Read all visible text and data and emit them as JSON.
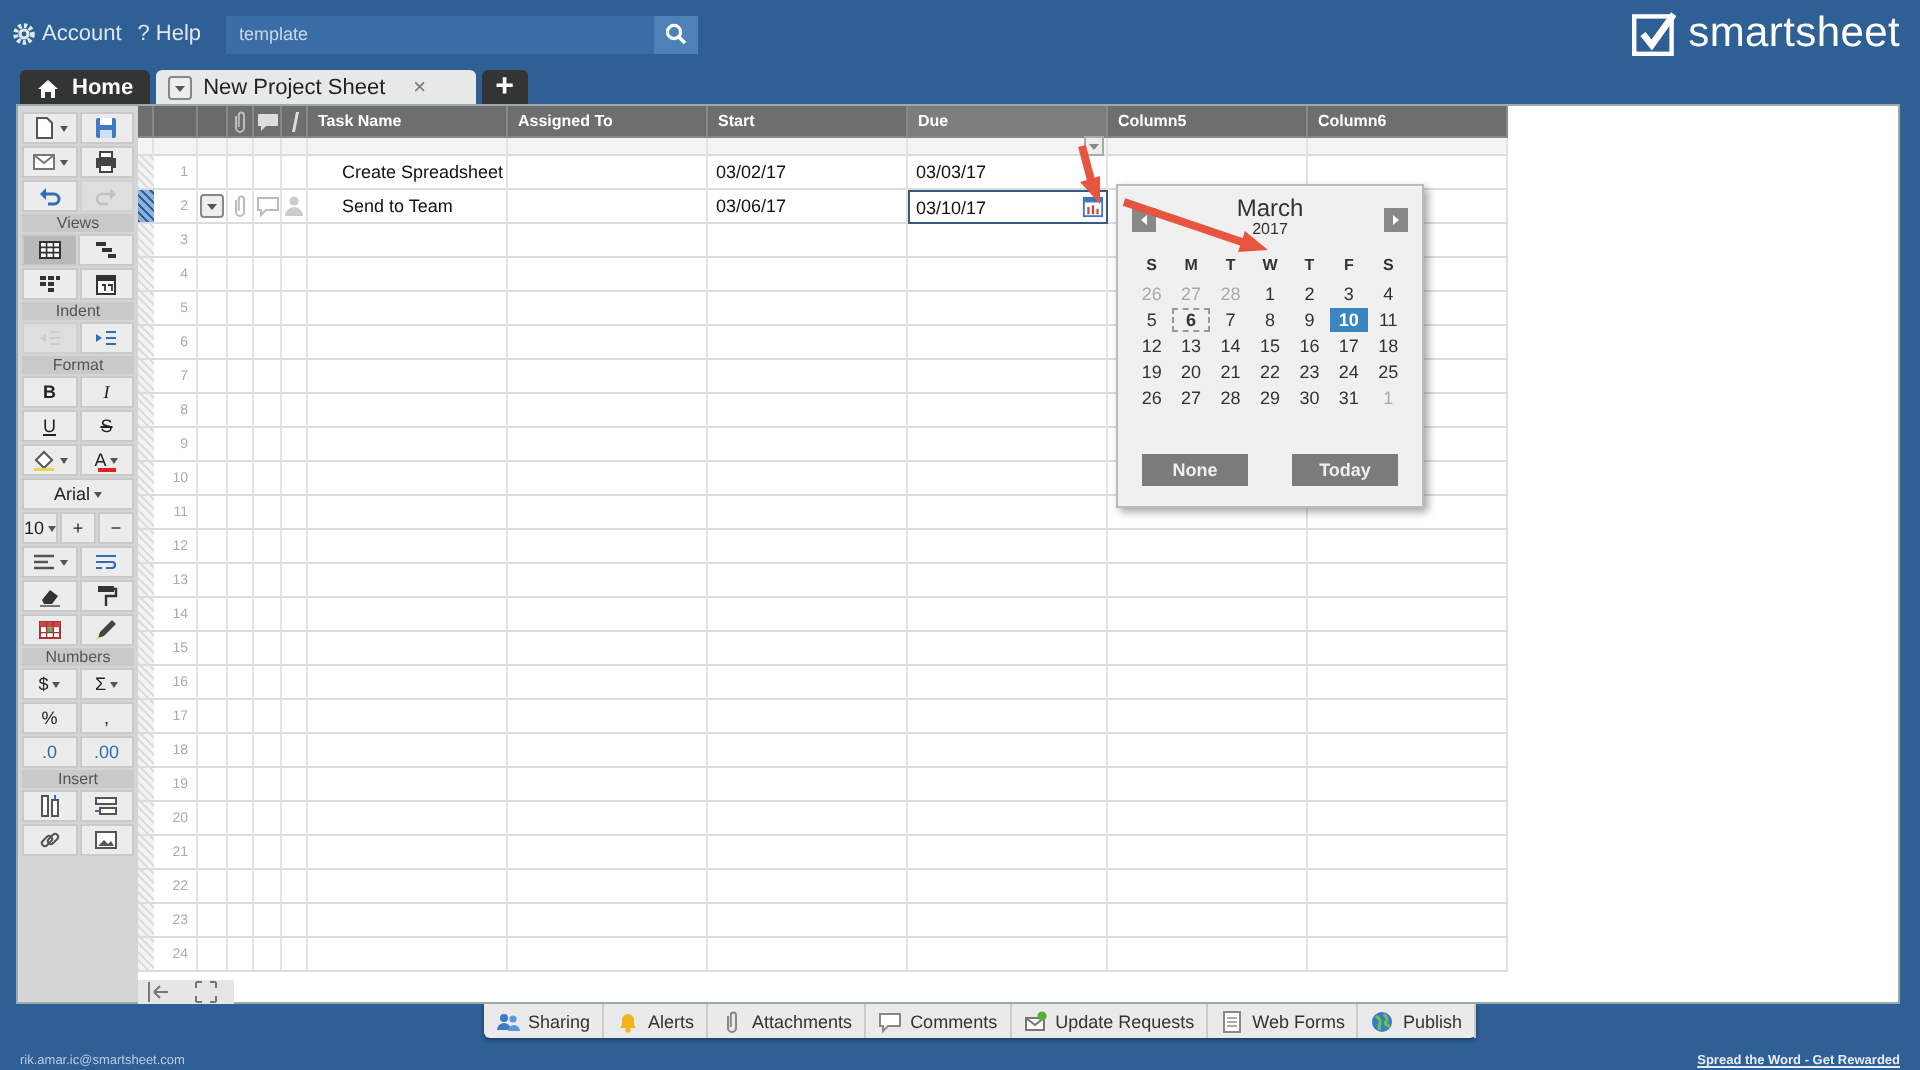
{
  "top_bar": {
    "account": "Account",
    "help": "? Help",
    "search": {
      "value": "template"
    },
    "logo": "smartsheet"
  },
  "tabs": [
    {
      "label": "Home",
      "kind": "home",
      "selected": false
    },
    {
      "label": "New Project Sheet",
      "kind": "sheet",
      "selected": true,
      "close": "×"
    },
    {
      "label": "+",
      "kind": "add",
      "selected": false
    }
  ],
  "toolbar": {
    "sections": [
      {
        "rows": [
          [
            {
              "kind": "new",
              "dropdown": true
            },
            {
              "kind": "save"
            }
          ],
          [
            {
              "kind": "email",
              "dropdown": true
            },
            {
              "kind": "print"
            }
          ],
          [
            {
              "kind": "undo",
              "disabled": false
            },
            {
              "kind": "redo",
              "disabled": true
            }
          ]
        ]
      },
      {
        "label": "Views",
        "rows": [
          [
            {
              "kind": "grid",
              "selected": true
            },
            {
              "kind": "gantt",
              "selected": false
            }
          ],
          [
            {
              "kind": "card",
              "selected": false
            },
            {
              "kind": "calendar",
              "selected": false
            }
          ]
        ]
      },
      {
        "label": "Indent",
        "rows": [
          [
            {
              "kind": "outdent",
              "disabled": true
            },
            {
              "kind": "indent",
              "disabled": false
            }
          ]
        ]
      },
      {
        "label": "Format",
        "rows": [
          [
            {
              "kind": "bold",
              "label": "B"
            },
            {
              "kind": "italic",
              "label": "I"
            }
          ],
          [
            {
              "kind": "underline",
              "label": "U"
            },
            {
              "kind": "strike",
              "label": "S"
            }
          ],
          [
            {
              "kind": "fill",
              "dropdown": true
            },
            {
              "kind": "fontcolor",
              "label": "A",
              "dropdown": true
            }
          ],
          [
            {
              "kind": "text",
              "label": "Arial",
              "dropdown": true
            }
          ],
          [
            {
              "kind": "text",
              "label": "10",
              "dropdown": true
            },
            {
              "kind": "text",
              "label": "+"
            },
            {
              "kind": "text",
              "label": "−"
            }
          ],
          [
            {
              "kind": "align",
              "dropdown": true
            },
            {
              "kind": "wrap"
            }
          ],
          [
            {
              "kind": "eraser"
            },
            {
              "kind": "roller"
            }
          ],
          [
            {
              "kind": "condfmt"
            },
            {
              "kind": "highlight"
            }
          ]
        ]
      },
      {
        "label": "Numbers",
        "rows": [
          [
            {
              "kind": "text",
              "label": "$",
              "dropdown": true
            },
            {
              "kind": "text",
              "label": "Σ",
              "dropdown": true
            }
          ],
          [
            {
              "kind": "text",
              "label": "%"
            },
            {
              "kind": "text",
              "label": ","
            }
          ],
          [
            {
              "kind": "decimal",
              "label": ".0"
            },
            {
              "kind": "decimal",
              "label": ".00"
            }
          ]
        ]
      },
      {
        "label": "Insert",
        "rows": [
          [
            {
              "kind": "insertcol"
            },
            {
              "kind": "insertrow"
            }
          ],
          [
            {
              "kind": "link"
            },
            {
              "kind": "image"
            }
          ]
        ]
      }
    ]
  },
  "sheet": {
    "columns": [
      "Task Name",
      "Assigned To",
      "Start",
      "Due",
      "Column5",
      "Column6"
    ],
    "rows": [
      {
        "number": "1",
        "selected": false,
        "task": "Create Spreadsheet",
        "start": "03/02/17",
        "due": "03/03/17",
        "due_editing": false
      },
      {
        "number": "2",
        "selected": true,
        "task": "Send to Team",
        "start": "03/06/17",
        "due": "03/10/17",
        "due_editing": true
      },
      {
        "number": "3",
        "selected": false
      },
      {
        "number": "4",
        "selected": false
      },
      {
        "number": "5",
        "selected": false
      },
      {
        "number": "6",
        "selected": false
      },
      {
        "number": "7",
        "selected": false
      },
      {
        "number": "8",
        "selected": false
      },
      {
        "number": "9",
        "selected": false
      },
      {
        "number": "10",
        "selected": false
      },
      {
        "number": "11",
        "selected": false
      },
      {
        "number": "12",
        "selected": false
      },
      {
        "number": "13",
        "selected": false
      },
      {
        "number": "14",
        "selected": false
      },
      {
        "number": "15",
        "selected": false
      },
      {
        "number": "16",
        "selected": false
      },
      {
        "number": "17",
        "selected": false
      },
      {
        "number": "18",
        "selected": false
      },
      {
        "number": "19",
        "selected": false
      },
      {
        "number": "20",
        "selected": false
      },
      {
        "number": "21",
        "selected": false
      },
      {
        "number": "22",
        "selected": false
      },
      {
        "number": "23",
        "selected": false
      },
      {
        "number": "24",
        "selected": false
      }
    ]
  },
  "date_picker": {
    "month": "March",
    "year": "2017",
    "weekdays": [
      "S",
      "M",
      "T",
      "W",
      "T",
      "F",
      "S"
    ],
    "weeks": [
      [
        {
          "day": "26",
          "other": true,
          "today": false,
          "selected": false
        },
        {
          "day": "27",
          "other": true,
          "today": false,
          "selected": false
        },
        {
          "day": "28",
          "other": true,
          "today": false,
          "selected": false
        },
        {
          "day": "1",
          "other": false,
          "today": false,
          "selected": false
        },
        {
          "day": "2",
          "other": false,
          "today": false,
          "selected": false
        },
        {
          "day": "3",
          "other": false,
          "today": false,
          "selected": false
        },
        {
          "day": "4",
          "other": false,
          "today": false,
          "selected": false
        }
      ],
      [
        {
          "day": "5",
          "other": false,
          "today": false,
          "selected": false
        },
        {
          "day": "6",
          "other": false,
          "today": true,
          "selected": false
        },
        {
          "day": "7",
          "other": false,
          "today": false,
          "selected": false
        },
        {
          "day": "8",
          "other": false,
          "today": false,
          "selected": false
        },
        {
          "day": "9",
          "other": false,
          "today": false,
          "selected": false
        },
        {
          "day": "10",
          "other": false,
          "today": false,
          "selected": true
        },
        {
          "day": "11",
          "other": false,
          "today": false,
          "selected": false
        }
      ],
      [
        {
          "day": "12",
          "other": false,
          "today": false,
          "selected": false
        },
        {
          "day": "13",
          "other": false,
          "today": false,
          "selected": false
        },
        {
          "day": "14",
          "other": false,
          "today": false,
          "selected": false
        },
        {
          "day": "15",
          "other": false,
          "today": false,
          "selected": false
        },
        {
          "day": "16",
          "other": false,
          "today": false,
          "selected": false
        },
        {
          "day": "17",
          "other": false,
          "today": false,
          "selected": false
        },
        {
          "day": "18",
          "other": false,
          "today": false,
          "selected": false
        }
      ],
      [
        {
          "day": "19",
          "other": false,
          "today": false,
          "selected": false
        },
        {
          "day": "20",
          "other": false,
          "today": false,
          "selected": false
        },
        {
          "day": "21",
          "other": false,
          "today": false,
          "selected": false
        },
        {
          "day": "22",
          "other": false,
          "today": false,
          "selected": false
        },
        {
          "day": "23",
          "other": false,
          "today": false,
          "selected": false
        },
        {
          "day": "24",
          "other": false,
          "today": false,
          "selected": false
        },
        {
          "day": "25",
          "other": false,
          "today": false,
          "selected": false
        }
      ],
      [
        {
          "day": "26",
          "other": false,
          "today": false,
          "selected": false
        },
        {
          "day": "27",
          "other": false,
          "today": false,
          "selected": false
        },
        {
          "day": "28",
          "other": false,
          "today": false,
          "selected": false
        },
        {
          "day": "29",
          "other": false,
          "today": false,
          "selected": false
        },
        {
          "day": "30",
          "other": false,
          "today": false,
          "selected": false
        },
        {
          "day": "31",
          "other": false,
          "today": false,
          "selected": false
        },
        {
          "day": "1",
          "other": true,
          "today": false,
          "selected": false
        }
      ]
    ],
    "buttons": [
      "None",
      "Today"
    ]
  },
  "bottom_tabs": [
    {
      "label": "Sharing",
      "kind": "sharing"
    },
    {
      "label": "Alerts",
      "kind": "alerts"
    },
    {
      "label": "Attachments",
      "kind": "attachments"
    },
    {
      "label": "Comments",
      "kind": "comments"
    },
    {
      "label": "Update Requests",
      "kind": "updates"
    },
    {
      "label": "Web Forms",
      "kind": "forms"
    },
    {
      "label": "Publish",
      "kind": "publish"
    }
  ],
  "footer": {
    "user": "rik.amar.ic@smartsheet.com",
    "link": "Spread the Word - Get Rewarded"
  }
}
